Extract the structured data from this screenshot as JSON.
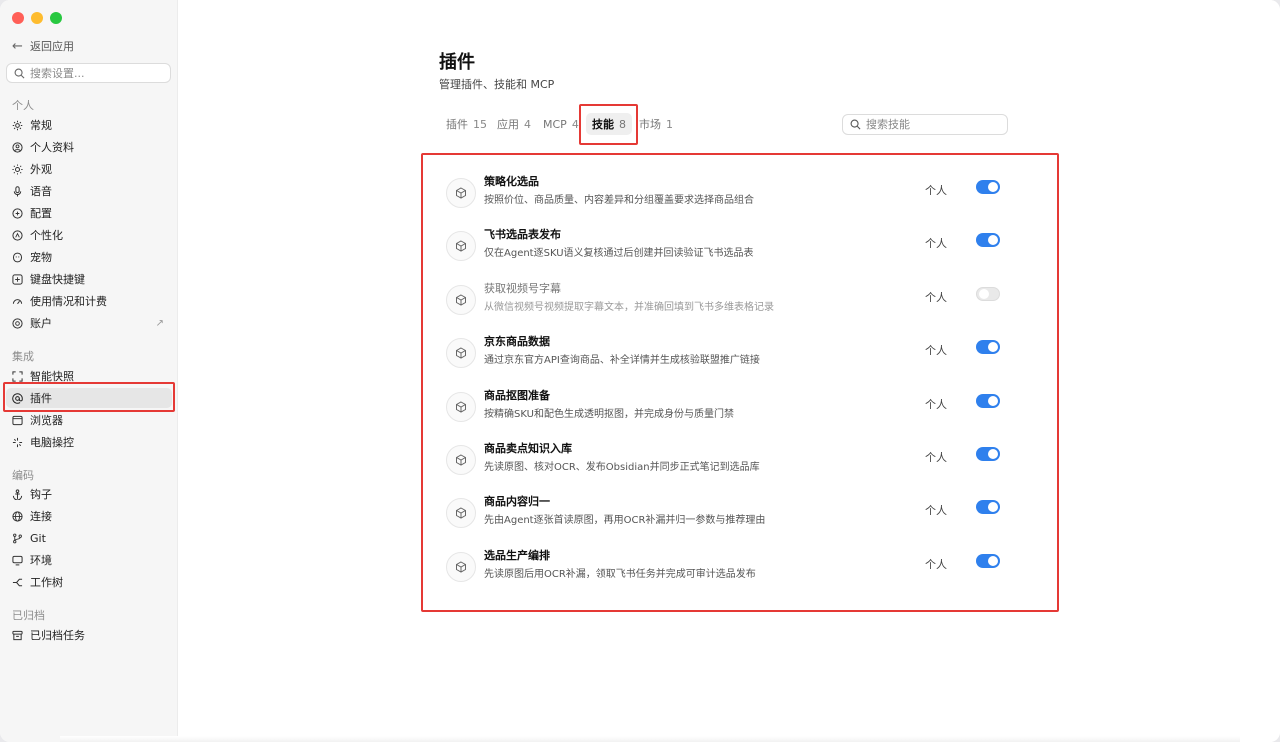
{
  "sidebar": {
    "back_label": "返回应用",
    "search_placeholder": "搜索设置...",
    "groups": {
      "personal": "个人",
      "integration": "集成",
      "coding": "编码",
      "archived": "已归档"
    },
    "items": {
      "general": "常规",
      "profile": "个人资料",
      "appearance": "外观",
      "voice": "语音",
      "config": "配置",
      "personalize": "个性化",
      "pet": "宠物",
      "shortcuts": "键盘快捷键",
      "usage": "使用情况和计费",
      "account": "账户",
      "snapshot": "智能快照",
      "plugins": "插件",
      "browser": "浏览器",
      "computer": "电脑操控",
      "hooks": "钩子",
      "connect": "连接",
      "git": "Git",
      "env": "环境",
      "worktree": "工作树",
      "archived_tasks": "已归档任务"
    }
  },
  "main": {
    "title": "插件",
    "subtitle": "管理插件、技能和 MCP",
    "tabs": [
      {
        "label": "插件",
        "count": "15"
      },
      {
        "label": "应用",
        "count": "4"
      },
      {
        "label": "MCP",
        "count": "4"
      },
      {
        "label": "技能",
        "count": "8"
      },
      {
        "label": "市场",
        "count": "1"
      }
    ],
    "search_placeholder": "搜索技能",
    "skills": [
      {
        "name": "策略化选品",
        "desc": "按照价位、商品质量、内容差异和分组覆盖要求选择商品组合",
        "scope": "个人",
        "enabled": true
      },
      {
        "name": "飞书选品表发布",
        "desc": "仅在Agent逐SKU语义复核通过后创建并回读验证飞书选品表",
        "scope": "个人",
        "enabled": true
      },
      {
        "name": "获取视频号字幕",
        "desc": "从微信视频号视频提取字幕文本，并准确回填到飞书多维表格记录",
        "scope": "个人",
        "enabled": false
      },
      {
        "name": "京东商品数据",
        "desc": "通过京东官方API查询商品、补全详情并生成核验联盟推广链接",
        "scope": "个人",
        "enabled": true
      },
      {
        "name": "商品抠图准备",
        "desc": "按精确SKU和配色生成透明抠图，并完成身份与质量门禁",
        "scope": "个人",
        "enabled": true
      },
      {
        "name": "商品卖点知识入库",
        "desc": "先读原图、核对OCR、发布Obsidian并同步正式笔记到选品库",
        "scope": "个人",
        "enabled": true
      },
      {
        "name": "商品内容归一",
        "desc": "先由Agent逐张首读原图，再用OCR补漏并归一参数与推荐理由",
        "scope": "个人",
        "enabled": true
      },
      {
        "name": "选品生产编排",
        "desc": "先读原图后用OCR补漏，领取飞书任务并完成可审计选品发布",
        "scope": "个人",
        "enabled": true
      }
    ]
  },
  "colors": {
    "accent": "#2f80ed",
    "highlight_box": "#e53935"
  },
  "icons": {
    "back": "arrow-left-icon",
    "search": "search-icon",
    "skill": "cube-icon",
    "external": "arrow-up-right-icon"
  }
}
